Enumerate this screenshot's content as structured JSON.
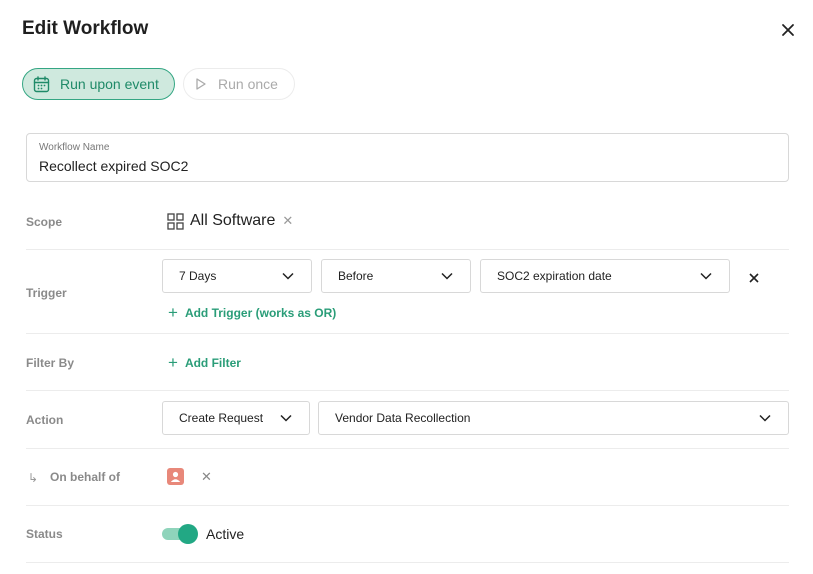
{
  "header": {
    "title": "Edit Workflow"
  },
  "modes": {
    "run_upon_event": "Run upon event",
    "run_once": "Run once"
  },
  "workflow_name": {
    "label": "Workflow Name",
    "value": "Recollect expired SOC2"
  },
  "scope": {
    "label": "Scope",
    "value": "All Software",
    "remove_glyph": "✕"
  },
  "trigger": {
    "label": "Trigger",
    "duration": "7 Days",
    "relation": "Before",
    "event": "SOC2 expiration date",
    "add_label": "Add Trigger (works as OR)"
  },
  "filter": {
    "label": "Filter By",
    "add_label": "Add Filter"
  },
  "action": {
    "label": "Action",
    "type": "Create Request",
    "value": "Vendor Data Recollection"
  },
  "behalf": {
    "label": "On behalf of",
    "arrow": "↳",
    "remove_glyph": "✕"
  },
  "status": {
    "label": "Status",
    "value": "Active",
    "enabled": true
  },
  "icons": {
    "plus": "+"
  },
  "colors": {
    "accent": "#2a9d78",
    "active_bg": "#cfe9de",
    "avatar": "#e8887a",
    "toggle_knob": "#22a884"
  }
}
